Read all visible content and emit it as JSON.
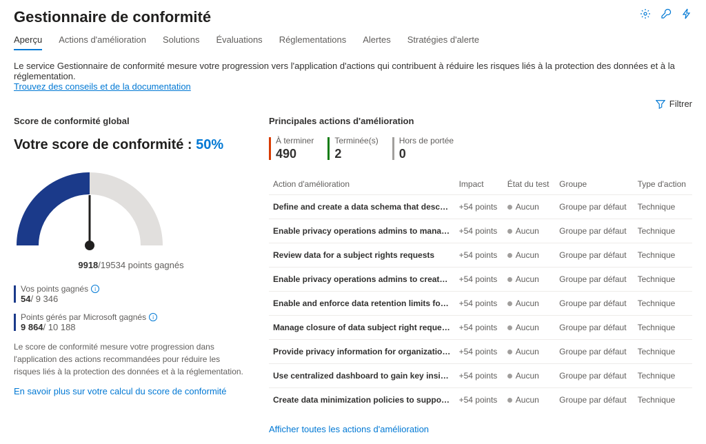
{
  "header": {
    "title": "Gestionnaire de conformité"
  },
  "tabs": [
    "Aperçu",
    "Actions d'amélioration",
    "Solutions",
    "Évaluations",
    "Réglementations",
    "Alertes",
    "Stratégies d'alerte"
  ],
  "intro": "Le service Gestionnaire de conformité mesure votre progression vers l'application d'actions qui contribuent à réduire les risques liés à la protection des données et à la réglementation.",
  "intro_link": "Trouvez des conseils et de la documentation",
  "filter_label": "Filtrer",
  "left": {
    "section_title": "Score de conformité global",
    "score_prefix": "Votre score de conformité : ",
    "score_pct": "50%",
    "points_earned": "9918",
    "points_total": "19534",
    "points_suffix": " points gagnés",
    "row1_label": "Vos points gagnés",
    "row1_val": "54",
    "row1_total": "/ 9 346",
    "row2_label": "Points gérés par Microsoft gagnés",
    "row2_val": "9 864",
    "row2_total": "/ 10 188",
    "desc": "Le score de conformité mesure votre progression dans l'application des actions recommandées pour réduire les risques liés à la protection des données et à la réglementation.",
    "learn_more": "En savoir plus sur votre calcul du score de conformité"
  },
  "right": {
    "section_title": "Principales actions d'amélioration",
    "kpis": [
      {
        "label": "À terminer",
        "value": "490",
        "color": "orange"
      },
      {
        "label": "Terminée(s)",
        "value": "2",
        "color": "green"
      },
      {
        "label": "Hors de portée",
        "value": "0",
        "color": "gray"
      }
    ],
    "columns": [
      "Action d'amélioration",
      "Impact",
      "État du test",
      "Groupe",
      "Type d'action"
    ],
    "rows": [
      {
        "name": "Define and create a data schema that describes attributes o...",
        "impact": "+54 points",
        "status": "Aucun",
        "group": "Groupe par défaut",
        "type": "Technique"
      },
      {
        "name": "Enable privacy operations admins to manage data collectio...",
        "impact": "+54 points",
        "status": "Aucun",
        "group": "Groupe par défaut",
        "type": "Technique"
      },
      {
        "name": "Review data for a subject rights requests",
        "impact": "+54 points",
        "status": "Aucun",
        "group": "Groupe par défaut",
        "type": "Technique"
      },
      {
        "name": "Enable privacy operations admins to create and support su...",
        "impact": "+54 points",
        "status": "Aucun",
        "group": "Groupe par défaut",
        "type": "Technique"
      },
      {
        "name": "Enable and enforce data retention limits for data involved i...",
        "impact": "+54 points",
        "status": "Aucun",
        "group": "Groupe par défaut",
        "type": "Technique"
      },
      {
        "name": "Manage closure of data subject right requests and provide ...",
        "impact": "+54 points",
        "status": "Aucun",
        "group": "Groupe par défaut",
        "type": "Technique"
      },
      {
        "name": "Provide privacy information for organizations",
        "impact": "+54 points",
        "status": "Aucun",
        "group": "Groupe par défaut",
        "type": "Technique"
      },
      {
        "name": "Use centralized dashboard to gain key insights about the lo...",
        "impact": "+54 points",
        "status": "Aucun",
        "group": "Groupe par défaut",
        "type": "Technique"
      },
      {
        "name": "Create data minimization policies to support privacy goals",
        "impact": "+54 points",
        "status": "Aucun",
        "group": "Groupe par défaut",
        "type": "Technique"
      }
    ],
    "view_all": "Afficher toutes les actions d'amélioration"
  },
  "chart_data": {
    "type": "gauge",
    "value": 9918,
    "max": 19534,
    "percent": 50,
    "title": "Score de conformité"
  }
}
